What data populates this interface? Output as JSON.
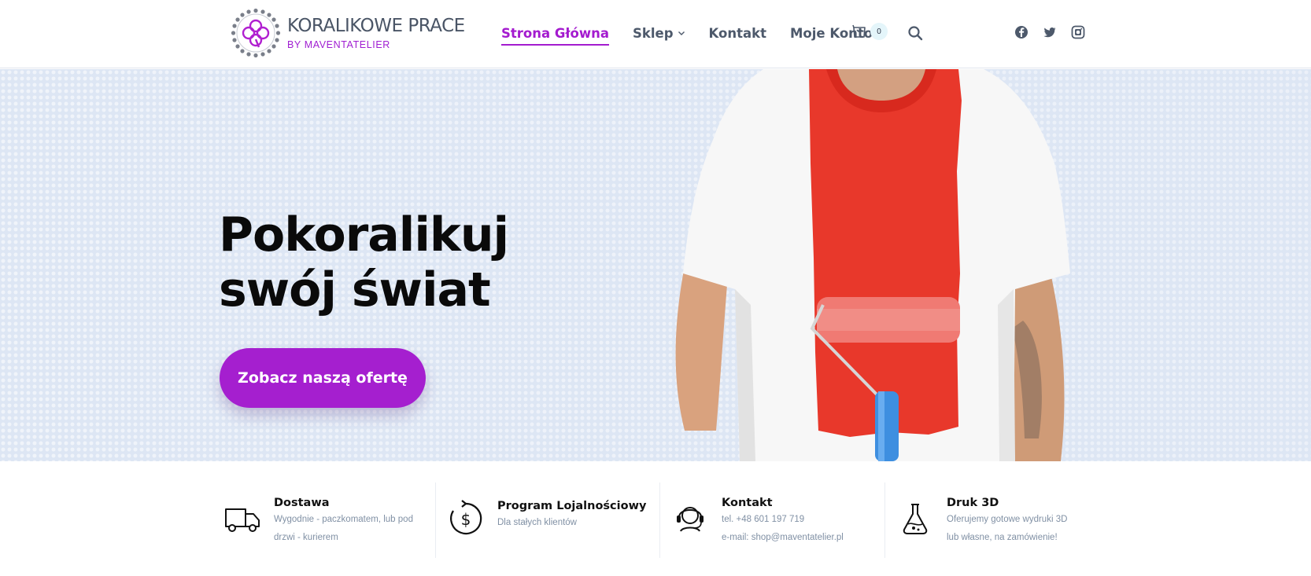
{
  "header": {
    "logo_title": "KORALIKOWE PRACE",
    "logo_sub": "BY MAVENTATELIER",
    "nav": [
      {
        "label": "Strona Główna",
        "active": true
      },
      {
        "label": "Sklep",
        "has_dropdown": true
      },
      {
        "label": "Kontakt"
      },
      {
        "label": "Moje Konto"
      }
    ],
    "cart_count": "0",
    "icons": [
      "cart-icon",
      "search-icon",
      "facebook-icon",
      "twitter-icon",
      "instagram-icon"
    ]
  },
  "hero": {
    "title_line1": "Pokoralikuj",
    "title_line2": "swój świat",
    "cta": "Zobacz naszą ofertę"
  },
  "features": [
    {
      "icon": "truck-icon",
      "title": "Dostawa",
      "lines": [
        "Wygodnie - paczkomatem, lub pod",
        "drzwi - kurierem"
      ]
    },
    {
      "icon": "loyalty-dollar-icon",
      "title": "Program Lojalnościowy",
      "lines": [
        "Dla stałych klientów"
      ]
    },
    {
      "icon": "headset-icon",
      "title": "Kontakt",
      "lines": [
        "tel. +48 601 197 719",
        "e-mail: shop@maventatelier.pl"
      ]
    },
    {
      "icon": "flask-icon",
      "title": "Druk 3D",
      "lines": [
        "Oferujemy gotowe wydruki 3D",
        "lub własne, na zamówienie!"
      ]
    }
  ],
  "colors": {
    "accent": "#a51fcf",
    "hero_bg": "#dde6f4",
    "text": "#4d596b"
  }
}
